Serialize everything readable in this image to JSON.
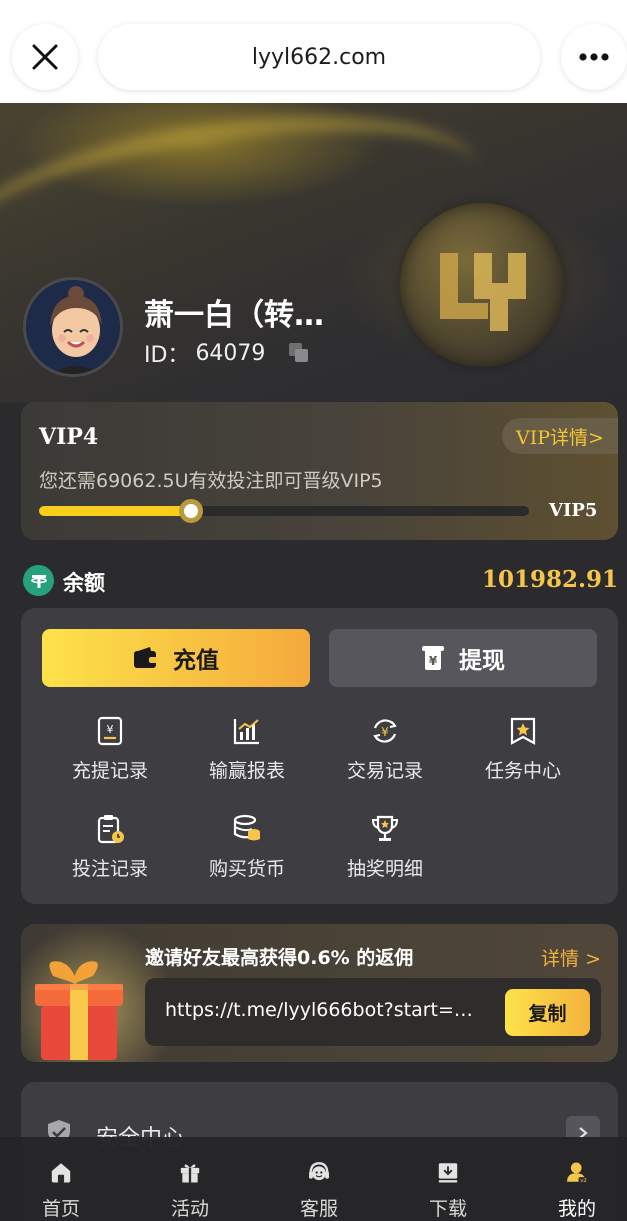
{
  "browser": {
    "url": "lyyl662.com"
  },
  "profile": {
    "name": "萧一白（转…",
    "id_label": "ID：",
    "id_value": "64079"
  },
  "vip": {
    "level": "VIP4",
    "detail_label": "VIP详情>",
    "hint": "您还需69062.5U有效投注即可晋级VIP5",
    "next_level": "VIP5",
    "progress": 0.31
  },
  "balance": {
    "label": "余额",
    "value": "101982.91"
  },
  "wallet": {
    "deposit_label": "充值",
    "withdraw_label": "提现",
    "grid": [
      {
        "label": "充提记录",
        "icon": "ledger-icon"
      },
      {
        "label": "输赢报表",
        "icon": "bar-chart-icon"
      },
      {
        "label": "交易记录",
        "icon": "yen-exchange-icon"
      },
      {
        "label": "任务中心",
        "icon": "star-badge-icon"
      },
      {
        "label": "投注记录",
        "icon": "clipboard-clock-icon"
      },
      {
        "label": "购买货币",
        "icon": "coin-stack-icon"
      },
      {
        "label": "抽奖明细",
        "icon": "trophy-icon"
      }
    ]
  },
  "invite": {
    "title": "邀请好友最高获得0.6% 的返佣",
    "detail_label": "详情 >",
    "link": "https://t.me/lyyl666bot?start=…",
    "copy_label": "复制"
  },
  "menu": {
    "security_label": "安全中心"
  },
  "nav": {
    "items": [
      {
        "label": "首页",
        "icon": "home-icon"
      },
      {
        "label": "活动",
        "icon": "gift-icon"
      },
      {
        "label": "客服",
        "icon": "headset-icon"
      },
      {
        "label": "下载",
        "icon": "download-icon"
      },
      {
        "label": "我的",
        "icon": "user-icon",
        "badge": "v2"
      }
    ]
  },
  "colors": {
    "accent_yellow": "#f7cf1b",
    "gold_text": "#f6c64a",
    "background": "#2b2b2e",
    "panel": "#3d3d42"
  }
}
